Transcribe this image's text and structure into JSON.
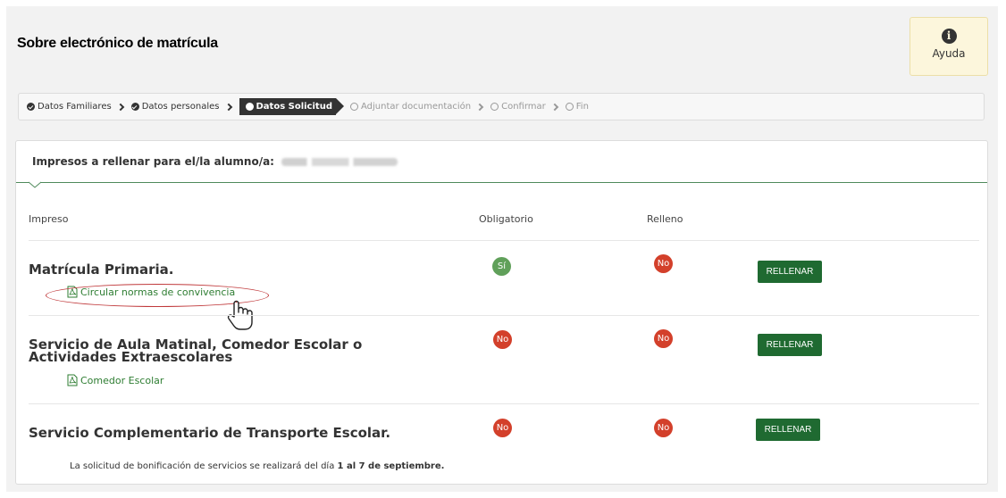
{
  "page": {
    "title": "Sobre electrónico de matrícula"
  },
  "help": {
    "icon": "info-icon",
    "label": "Ayuda"
  },
  "steps": [
    {
      "label": "Datos Familiares",
      "state": "done"
    },
    {
      "label": "Datos personales",
      "state": "done"
    },
    {
      "label": "Datos Solicitud",
      "state": "active"
    },
    {
      "label": "Adjuntar documentación",
      "state": "pending"
    },
    {
      "label": "Confirmar",
      "state": "pending"
    },
    {
      "label": "Fin",
      "state": "pending"
    }
  ],
  "card": {
    "header": "Impresos a rellenar para el/la alumno/a:"
  },
  "columns": {
    "impreso": "Impreso",
    "obligatorio": "Obligatorio",
    "relleno": "Relleno"
  },
  "rows": [
    {
      "title": "Matrícula Primaria.",
      "doc": "Circular normas de convivencia",
      "obligatorio": "Sí",
      "relleno": "No",
      "button": "RELLENAR"
    },
    {
      "title_line1": "Servicio de Aula Matinal, Comedor Escolar o",
      "title_line2": "Actividades Extraescolares",
      "doc": "Comedor Escolar",
      "obligatorio": "No",
      "relleno": "No",
      "button": "RELLENAR"
    },
    {
      "title": "Servicio Complementario de Transporte Escolar.",
      "obligatorio": "No",
      "relleno": "No",
      "button": "RELLENAR"
    }
  ],
  "note": {
    "text": "La solicitud de bonificación de servicios se realizará del día",
    "bold": "1 al 7 de septiembre."
  },
  "colors": {
    "accent_green": "#1f6a31",
    "yes_badge": "#60a05a",
    "no_badge": "#d3402b",
    "help_bg": "#fcf6dc"
  }
}
